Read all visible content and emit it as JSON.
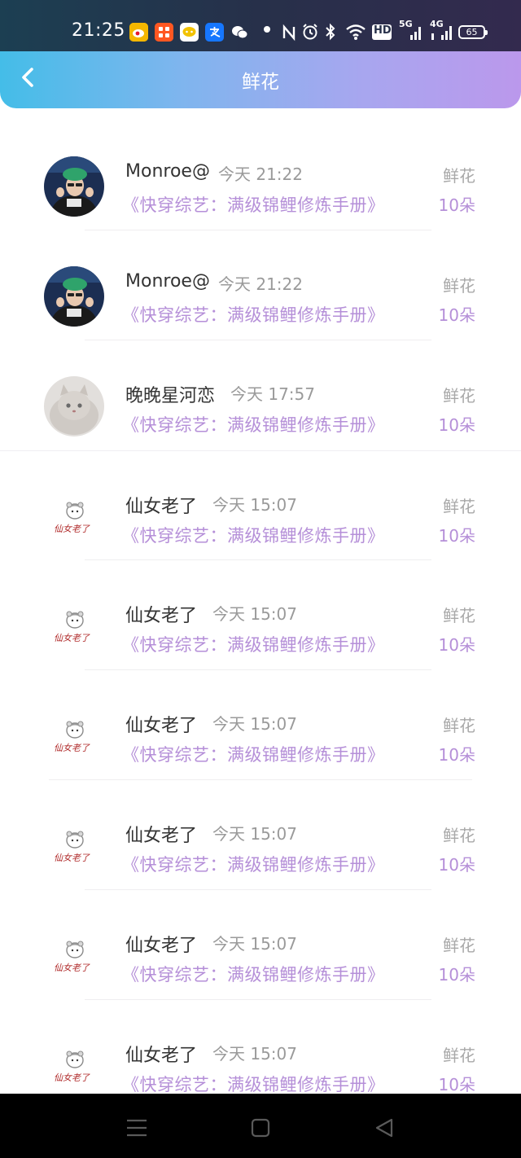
{
  "status_bar": {
    "time": "21:25",
    "icons": [
      "weibo-icon",
      "app-icon",
      "message-app-icon",
      "alipay-icon",
      "wechat-icon",
      "dot-icon",
      "nfc-icon",
      "alarm-icon",
      "bluetooth-icon",
      "wifi-icon",
      "hd-icon",
      "5g-signal-icon",
      "4g-signal-icon"
    ],
    "hd_label": "HD",
    "net_5g": "5G",
    "net_4g": "4G",
    "battery": "65"
  },
  "header": {
    "title": "鲜花",
    "gradient_start": "#44bde8",
    "gradient_end": "#bb98ec"
  },
  "colors": {
    "accent_purple": "#b58fd8",
    "gray_text": "#9a9a9a",
    "name_text": "#333333"
  },
  "items": [
    {
      "username": "Monroe@",
      "time": "今天 21:22",
      "book": "《快穿综艺：满级锦鲤修炼手册》",
      "gift": "鲜花",
      "count": "10朵",
      "avatar": "photo-avatar-green-hat"
    },
    {
      "username": "Monroe@",
      "time": "今天 21:22",
      "book": "《快穿综艺：满级锦鲤修炼手册》",
      "gift": "鲜花",
      "count": "10朵",
      "avatar": "photo-avatar-green-hat"
    },
    {
      "username": "晚晚星河恋",
      "time": "今天 17:57",
      "book": "《快穿综艺：满级锦鲤修炼手册》",
      "gift": "鲜花",
      "count": "10朵",
      "avatar": "cat-avatar"
    },
    {
      "username": "仙女老了",
      "time": "今天 15:07",
      "book": "《快穿综艺：满级锦鲤修炼手册》",
      "gift": "鲜花",
      "count": "10朵",
      "avatar": "hamster-avatar"
    },
    {
      "username": "仙女老了",
      "time": "今天 15:07",
      "book": "《快穿综艺：满级锦鲤修炼手册》",
      "gift": "鲜花",
      "count": "10朵",
      "avatar": "hamster-avatar"
    },
    {
      "username": "仙女老了",
      "time": "今天 15:07",
      "book": "《快穿综艺：满级锦鲤修炼手册》",
      "gift": "鲜花",
      "count": "10朵",
      "avatar": "hamster-avatar"
    },
    {
      "username": "仙女老了",
      "time": "今天 15:07",
      "book": "《快穿综艺：满级锦鲤修炼手册》",
      "gift": "鲜花",
      "count": "10朵",
      "avatar": "hamster-avatar"
    },
    {
      "username": "仙女老了",
      "time": "今天 15:07",
      "book": "《快穿综艺：满级锦鲤修炼手册》",
      "gift": "鲜花",
      "count": "10朵",
      "avatar": "hamster-avatar"
    },
    {
      "username": "仙女老了",
      "time": "今天 15:07",
      "book": "《快穿综艺：满级锦鲤修炼手册》",
      "gift": "鲜花",
      "count": "10朵",
      "avatar": "hamster-avatar"
    }
  ],
  "hamster_caption": "仙女老了",
  "nav": {
    "buttons": [
      "menu-icon",
      "home-icon",
      "back-triangle-icon"
    ]
  }
}
